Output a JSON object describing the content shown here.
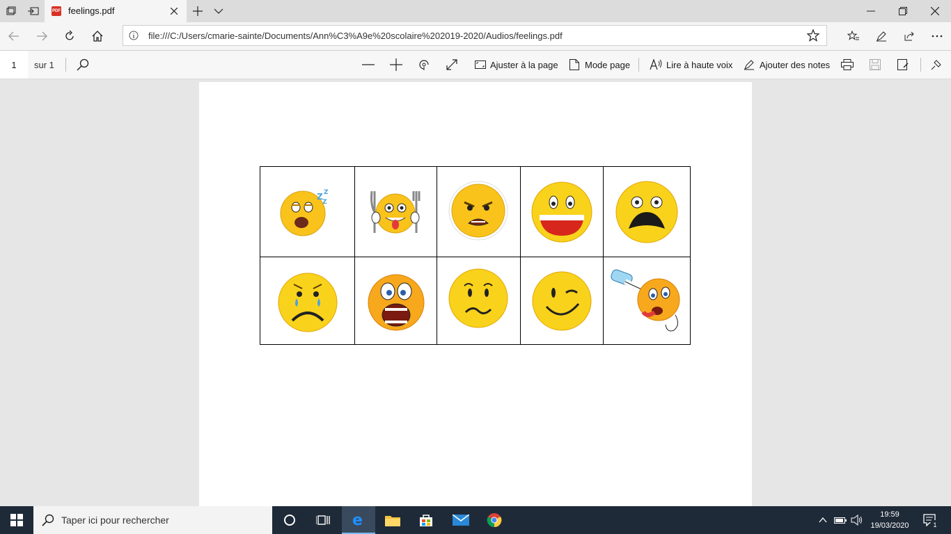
{
  "browser": {
    "tab_title": "feelings.pdf",
    "tab_favicon_text": "PDF",
    "url": "file:///C:/Users/cmarie-sainte/Documents/Ann%C3%A9e%20scolaire%202019-2020/Audios/feelings.pdf"
  },
  "pdf_toolbar": {
    "page_number": "1",
    "page_count": "sur 1",
    "fit_page_label": "Ajuster à la page",
    "page_mode_label": "Mode page",
    "read_aloud_label": "Lire à haute voix",
    "add_notes_label": "Ajouter des notes"
  },
  "document": {
    "emotions": [
      [
        "sleepy-tired",
        "hungry",
        "angry",
        "happy",
        "surprised-shocked"
      ],
      [
        "sad-crying",
        "scared",
        "worried",
        "winking",
        "thirsty"
      ]
    ]
  },
  "taskbar": {
    "search_placeholder": "Taper ici pour rechercher",
    "time": "19:59",
    "date": "19/03/2020",
    "notification_count": "1"
  },
  "colors": {
    "accent": "#0078d7",
    "taskbar": "#1f2a38",
    "emoji_yellow": "#f9d21c"
  }
}
